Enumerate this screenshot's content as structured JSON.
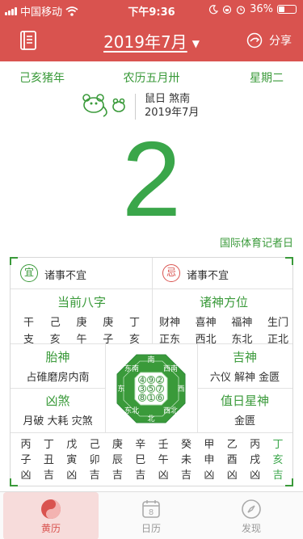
{
  "status": {
    "carrier": "中国移动",
    "time": "下午9:36",
    "battery": "36%",
    "battery_level": 0.36
  },
  "header": {
    "title": "2019年7月",
    "share_label": "分享"
  },
  "date_info": {
    "ganzhi_year": "己亥猪年",
    "lunar": "农历五月卅",
    "weekday": "星期二",
    "day_sha": "鼠日 煞南",
    "year_month": "2019年7月",
    "day": "2",
    "festival": "国际体育记者日"
  },
  "yi": {
    "badge": "宜",
    "text": "诸事不宜"
  },
  "ji": {
    "badge": "忌",
    "text": "诸事不宜"
  },
  "bazi": {
    "title": "当前八字",
    "top": [
      "干",
      "己",
      "庚",
      "庚",
      "丁"
    ],
    "bottom": [
      "支",
      "亥",
      "午",
      "子",
      "亥"
    ]
  },
  "directions": {
    "title": "诸神方位",
    "top": [
      "财神",
      "喜神",
      "福神",
      "生门"
    ],
    "bottom": [
      "正东",
      "西北",
      "东北",
      "正北"
    ]
  },
  "taishen": {
    "title": "胎神",
    "text": "占碓磨房内南"
  },
  "jishen": {
    "title": "吉神",
    "text": "六仪 解神 金匮"
  },
  "xiongsha": {
    "title": "凶煞",
    "text": "月破 大耗 灾煞"
  },
  "zhishen": {
    "title": "值日星神",
    "text": "金匮"
  },
  "compass": {
    "nw": "东南",
    "ne": "西南",
    "sw": "东北",
    "se": "西北",
    "n": "南",
    "s": "北",
    "w": "东",
    "e": "西",
    "grid": [
      "4",
      "9",
      "2",
      "3",
      "5",
      "7",
      "8",
      "1",
      "6"
    ]
  },
  "hours": {
    "stems": [
      "丙",
      "丁",
      "戊",
      "己",
      "庚",
      "辛",
      "壬",
      "癸",
      "甲",
      "乙",
      "丙",
      "丁"
    ],
    "branches": [
      "子",
      "丑",
      "寅",
      "卯",
      "辰",
      "巳",
      "午",
      "未",
      "申",
      "酉",
      "戌",
      "亥"
    ],
    "luck": [
      "凶",
      "吉",
      "凶",
      "吉",
      "吉",
      "吉",
      "凶",
      "吉",
      "凶",
      "凶",
      "凶",
      "吉"
    ]
  },
  "tabs": [
    {
      "label": "黄历"
    },
    {
      "label": "日历"
    },
    {
      "label": "发现"
    }
  ],
  "colors": {
    "brand_red": "#d9534f",
    "accent_green": "#3aa64a"
  }
}
